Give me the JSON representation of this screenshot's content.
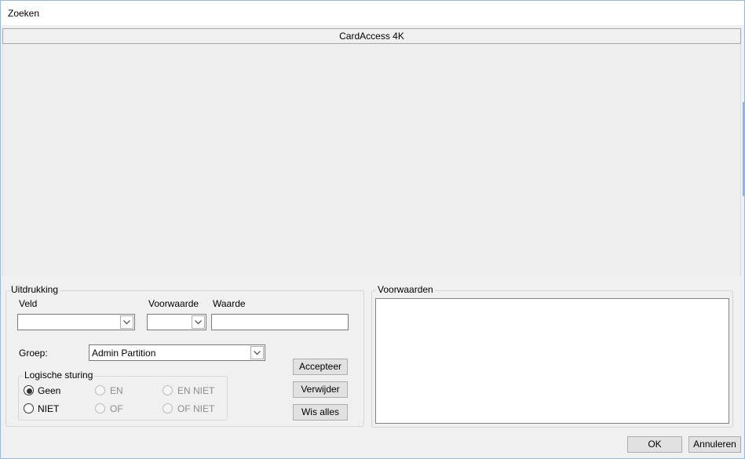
{
  "window": {
    "title": "Zoeken"
  },
  "header": {
    "tab_label": "CardAccess 4K"
  },
  "expression": {
    "group_title": "Uitdrukking",
    "field_label": "Veld",
    "field_value": "",
    "condition_label": "Voorwaarde",
    "condition_value": "",
    "value_label": "Waarde",
    "value_input": "",
    "group_label": "Groep:",
    "group_value": "Admin Partition"
  },
  "logic": {
    "title": "Logische sturing",
    "options": [
      {
        "label": "Geen",
        "checked": true,
        "enabled": true
      },
      {
        "label": "EN",
        "checked": false,
        "enabled": false
      },
      {
        "label": "EN NIET",
        "checked": false,
        "enabled": false
      },
      {
        "label": "NIET",
        "checked": false,
        "enabled": true
      },
      {
        "label": "OF",
        "checked": false,
        "enabled": false
      },
      {
        "label": "OF NIET",
        "checked": false,
        "enabled": false
      }
    ]
  },
  "actions": {
    "accept_label": "Accepteer",
    "delete_label": "Verwijder",
    "clear_all_label": "Wis alles"
  },
  "conditions": {
    "group_title": "Voorwaarden",
    "items": []
  },
  "footer": {
    "ok_label": "OK",
    "cancel_label": "Annuleren"
  },
  "icons": {
    "dropdown": "chevron-down-icon"
  },
  "colors": {
    "background": "#f0f0f0",
    "window_border": "#9bb8d8"
  }
}
